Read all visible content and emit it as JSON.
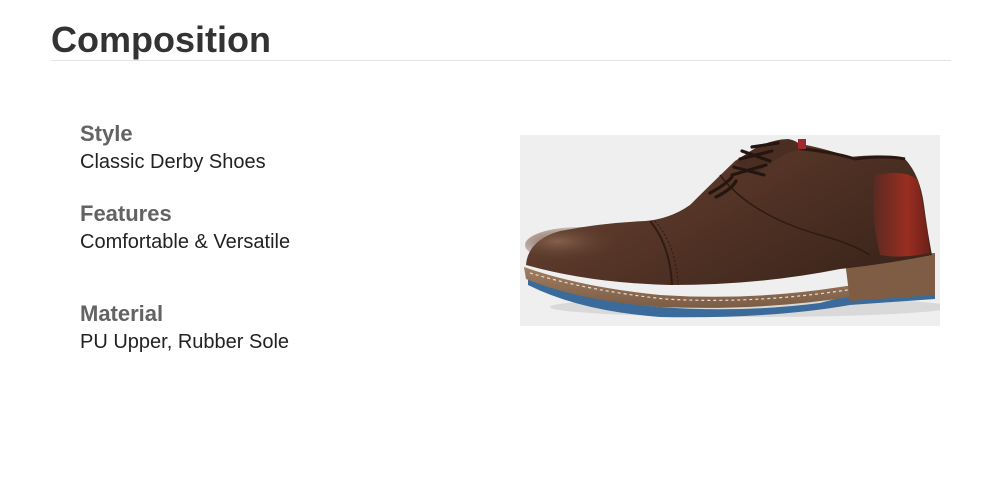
{
  "header": {
    "title": "Composition"
  },
  "specs": [
    {
      "label": "Style",
      "value": "Classic Derby Shoes"
    },
    {
      "label": "Features",
      "value": "Comfortable & Versatile"
    },
    {
      "label": "Material",
      "value": "PU Upper, Rubber Sole"
    }
  ],
  "image": {
    "subject": "brown-leather-derby-shoe",
    "colors": {
      "leather": "#5a3a2c",
      "heel_accent": "#8b2a1f",
      "sole": "#8a6a52",
      "outsole": "#3a6b9a",
      "background": "#efefef"
    }
  }
}
